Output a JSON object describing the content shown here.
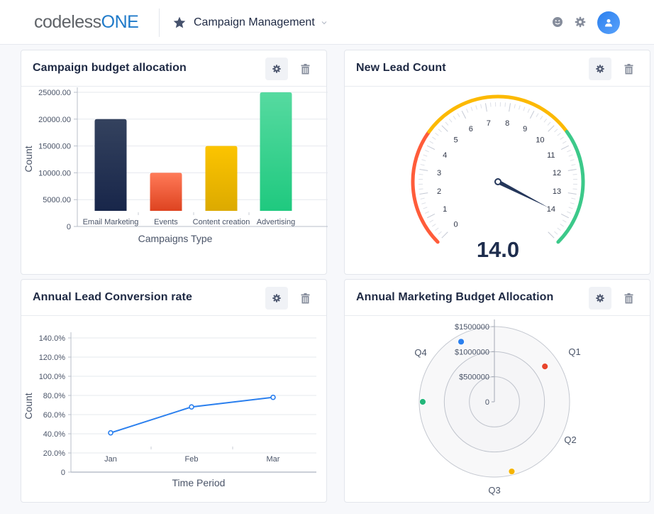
{
  "header": {
    "logo_part1": "codeless",
    "logo_part2": "ONE",
    "app_title": "Campaign Management",
    "icons": [
      "smiley-icon",
      "gear-icon",
      "user-avatar-icon"
    ]
  },
  "colors": {
    "brand": "#1f7ac9",
    "navy": "#1f2a44",
    "accent_blue": "#2a7fee"
  },
  "widgets": [
    {
      "title": "Campaign budget allocation",
      "actions": [
        "settings",
        "delete"
      ]
    },
    {
      "title": "New Lead Count",
      "actions": [
        "settings",
        "delete"
      ]
    },
    {
      "title": "Annual Lead Conversion rate",
      "actions": [
        "settings",
        "delete"
      ]
    },
    {
      "title": "Annual Marketing Budget Allocation",
      "actions": [
        "settings",
        "delete"
      ]
    }
  ],
  "chart_data": [
    {
      "type": "bar",
      "title": "Campaign budget allocation",
      "xlabel": "Campaigns Type",
      "ylabel": "Count",
      "categories": [
        "Email Marketing",
        "Events",
        "Content creation",
        "Advertising"
      ],
      "values": [
        20000,
        10000,
        15000,
        25000
      ],
      "colors": [
        [
          "#34425e",
          "#18264a"
        ],
        [
          "#ff7a58",
          "#de4320"
        ],
        [
          "#fcc400",
          "#dcaa00"
        ],
        [
          "#56daa0",
          "#1fc97f"
        ]
      ],
      "yticks": [
        "0",
        "5000.00",
        "10000.00",
        "15000.00",
        "20000.00",
        "25000.00"
      ],
      "ylim": [
        0,
        25000
      ],
      "grid": true
    },
    {
      "type": "gauge",
      "title": "New Lead Count",
      "value": 14.0,
      "value_label": "14.0",
      "min": 0,
      "max": 15,
      "tick_labels": [
        "0",
        "1",
        "2",
        "3",
        "4",
        "5",
        "6",
        "7",
        "8",
        "9",
        "10",
        "11",
        "12",
        "13",
        "14"
      ],
      "bands": [
        {
          "from": 0,
          "to": 4.5,
          "color": "#ff5c3a"
        },
        {
          "from": 4.5,
          "to": 10.5,
          "color": "#fcb900"
        },
        {
          "from": 10.5,
          "to": 15,
          "color": "#3cc98a"
        }
      ]
    },
    {
      "type": "line",
      "title": "Annual Lead Conversion rate",
      "xlabel": "Time Period",
      "ylabel": "Count",
      "categories": [
        "Jan",
        "Feb",
        "Mar"
      ],
      "values": [
        41,
        68,
        78
      ],
      "yticks": [
        "0",
        "20.0%",
        "40.0%",
        "60.0%",
        "80.0%",
        "100.0%",
        "120.0%",
        "140.0%"
      ],
      "ylim": [
        0,
        140
      ],
      "color": "#2a7fee",
      "grid": true
    },
    {
      "type": "polar-scatter",
      "title": "Annual Marketing Budget Allocation",
      "categories": [
        "Q1",
        "Q2",
        "Q3",
        "Q4"
      ],
      "values": [
        1230000,
        1370000,
        1430000,
        1430000
      ],
      "colors": [
        "#e8452c",
        "#2a7fee",
        "#23b77a",
        "#f5b400"
      ],
      "rticks": [
        "0",
        "$500000",
        "$1000000",
        "$1500000"
      ],
      "rlim": [
        0,
        1500000
      ]
    }
  ]
}
